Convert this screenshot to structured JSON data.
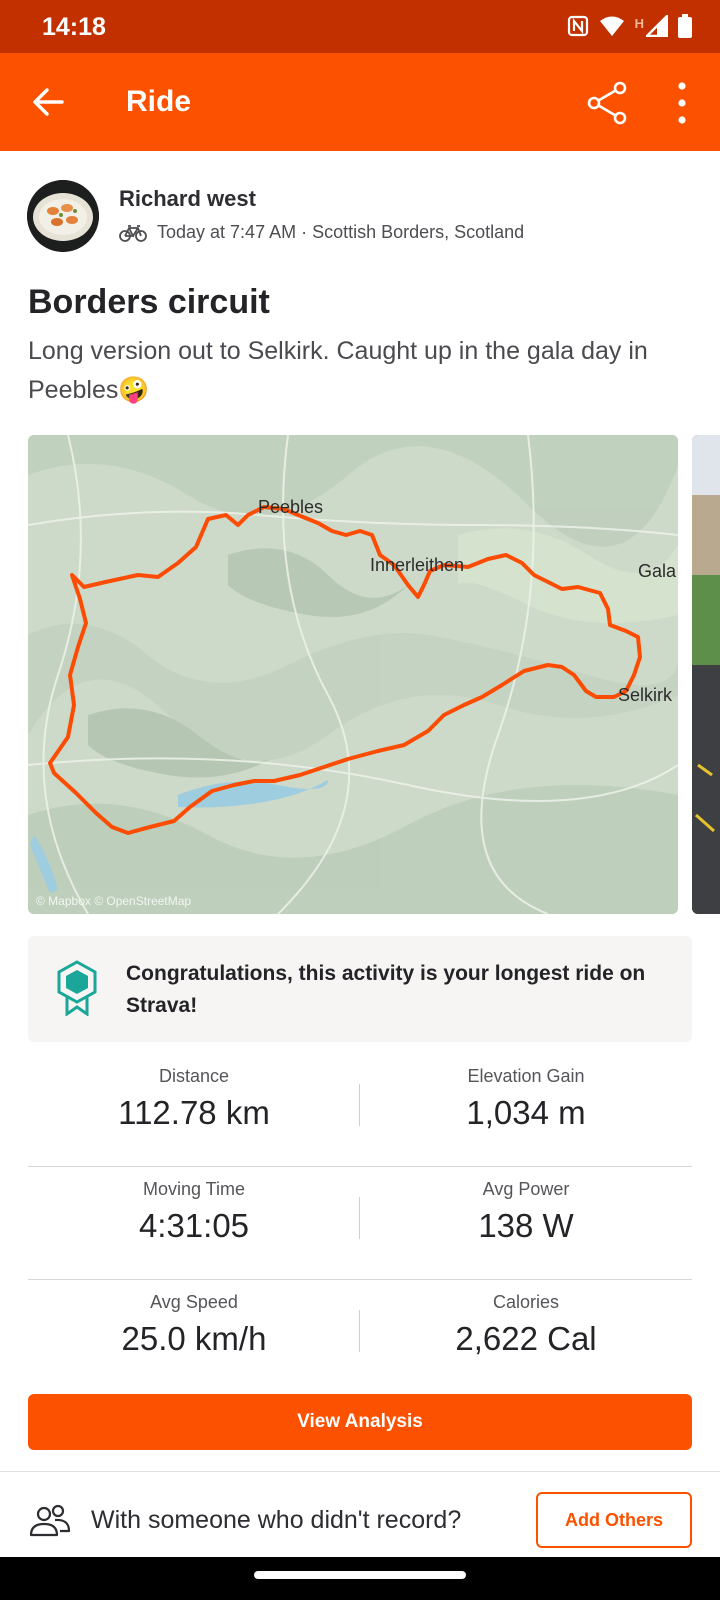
{
  "status_bar": {
    "time": "14:18",
    "network_letter": "H",
    "icons": [
      "nfc-icon",
      "wifi-icon",
      "signal-icon",
      "battery-icon"
    ]
  },
  "app_bar": {
    "title": "Ride",
    "icons": [
      "back-arrow-icon",
      "share-icon",
      "more-vertical-icon"
    ]
  },
  "athlete": {
    "name": "Richard west",
    "activity_icon": "bike-icon",
    "meta": "Today at 7:47 AM · Scottish Borders, Scotland"
  },
  "activity": {
    "title": "Borders circuit",
    "description": "Long version out to Selkirk.  Caught up in the gala day in Peebles",
    "description_emoji": "🤪"
  },
  "map": {
    "place_labels": [
      "Peebles",
      "Innerleithen",
      "Gala",
      "Selkirk"
    ],
    "attribution": "© Mapbox © OpenStreetMap",
    "route_color": "#fc4c02"
  },
  "achievement": {
    "icon": "achievement-badge-icon",
    "text": "Congratulations, this activity is your longest ride on Strava!"
  },
  "stats": [
    {
      "label": "Distance",
      "value": "112.78 km"
    },
    {
      "label": "Elevation Gain",
      "value": "1,034 m"
    },
    {
      "label": "Moving Time",
      "value": "4:31:05"
    },
    {
      "label": "Avg Power",
      "value": "138 W"
    },
    {
      "label": "Avg Speed",
      "value": "25.0 km/h"
    },
    {
      "label": "Calories",
      "value": "2,622 Cal"
    }
  ],
  "actions": {
    "view_analysis": "View Analysis",
    "prompt": "With someone who didn't record?",
    "add_others": "Add Others"
  },
  "colors": {
    "brand": "#fc5200",
    "status_bar": "#c23000",
    "achievement_teal": "#1aa79a"
  }
}
